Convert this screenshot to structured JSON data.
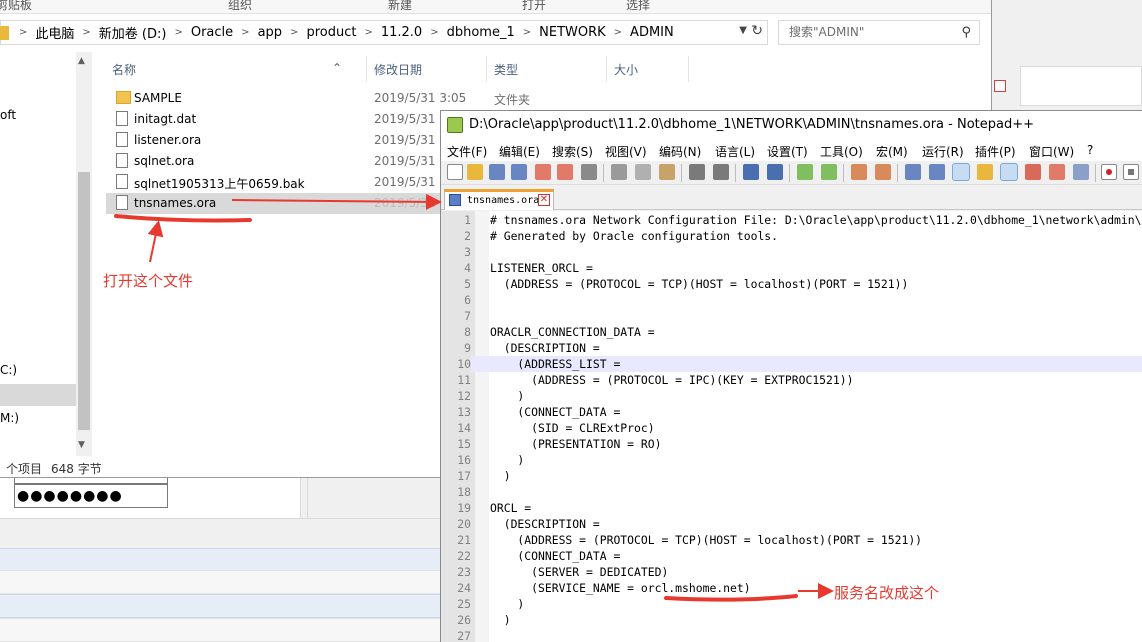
{
  "explorer": {
    "ribbon_groups": [
      "剪贴板",
      "组织",
      "新建",
      "打开",
      "选择"
    ],
    "breadcrumb": [
      "此电脑",
      "新加卷 (D:)",
      "Oracle",
      "app",
      "product",
      "11.2.0",
      "dbhome_1",
      "NETWORK",
      "ADMIN"
    ],
    "search_placeholder": "搜索\"ADMIN\"",
    "nav_items": [
      "oft",
      "C:)",
      "M:)"
    ],
    "columns": {
      "name": "名称",
      "date": "修改日期",
      "type": "类型",
      "size": "大小"
    },
    "files": [
      {
        "name": "SAMPLE",
        "date": "2019/5/31 3:05",
        "type": "文件夹"
      },
      {
        "name": "initagt.dat",
        "date": "2019/5/31",
        "type": ""
      },
      {
        "name": "listener.ora",
        "date": "2019/5/31",
        "type": ""
      },
      {
        "name": "sqlnet.ora",
        "date": "2019/5/31",
        "type": ""
      },
      {
        "name": "sqlnet1905313上午0659.bak",
        "date": "2019/5/31",
        "type": ""
      },
      {
        "name": "tnsnames.ora",
        "date": "2019/5/31",
        "type": ""
      }
    ],
    "status_items": "个项目",
    "status_size": "648 字节"
  },
  "background": {
    "password_mask": "●●●●●●●●"
  },
  "notepad": {
    "title": "D:\\Oracle\\app\\product\\11.2.0\\dbhome_1\\NETWORK\\ADMIN\\tnsnames.ora - Notepad++",
    "menu": [
      "文件(F)",
      "编辑(E)",
      "搜索(S)",
      "视图(V)",
      "编码(N)",
      "语言(L)",
      "设置(T)",
      "工具(O)",
      "宏(M)",
      "运行(R)",
      "插件(P)",
      "窗口(W)",
      "?"
    ],
    "tab_label": "tnsnames.ora",
    "lines": [
      "# tnsnames.ora Network Configuration File: D:\\Oracle\\app\\product\\11.2.0\\dbhome_1\\network\\admin\\tnsnames.ora",
      "# Generated by Oracle configuration tools.",
      "",
      "LISTENER_ORCL =",
      "  (ADDRESS = (PROTOCOL = TCP)(HOST = localhost)(PORT = 1521))",
      "",
      "",
      "ORACLR_CONNECTION_DATA =",
      "  (DESCRIPTION =",
      "    (ADDRESS_LIST =",
      "      (ADDRESS = (PROTOCOL = IPC)(KEY = EXTPROC1521))",
      "    )",
      "    (CONNECT_DATA =",
      "      (SID = CLRExtProc)",
      "      (PRESENTATION = RO)",
      "    )",
      "  )",
      "",
      "ORCL =",
      "  (DESCRIPTION =",
      "    (ADDRESS = (PROTOCOL = TCP)(HOST = localhost)(PORT = 1521))",
      "    (CONNECT_DATA =",
      "      (SERVER = DEDICATED)",
      "      (SERVICE_NAME = orcl.mshome.net)",
      "    )",
      "  )",
      ""
    ],
    "line_numbers": [
      "1",
      "2",
      "3",
      "4",
      "5",
      "6",
      "7",
      "8",
      "9",
      "10",
      "11",
      "12",
      "13",
      "14",
      "15",
      "16",
      "17",
      "18",
      "19",
      "20",
      "21",
      "22",
      "23",
      "24",
      "25",
      "26",
      "27"
    ],
    "current_line": 10
  },
  "annotations": {
    "open_file": "打开这个文件",
    "change_service": "服务名改成这个"
  },
  "colors": {
    "annotation": "#e8392f",
    "current_line_bg": "#e8e8ff",
    "tab_accent": "#f0a030"
  }
}
